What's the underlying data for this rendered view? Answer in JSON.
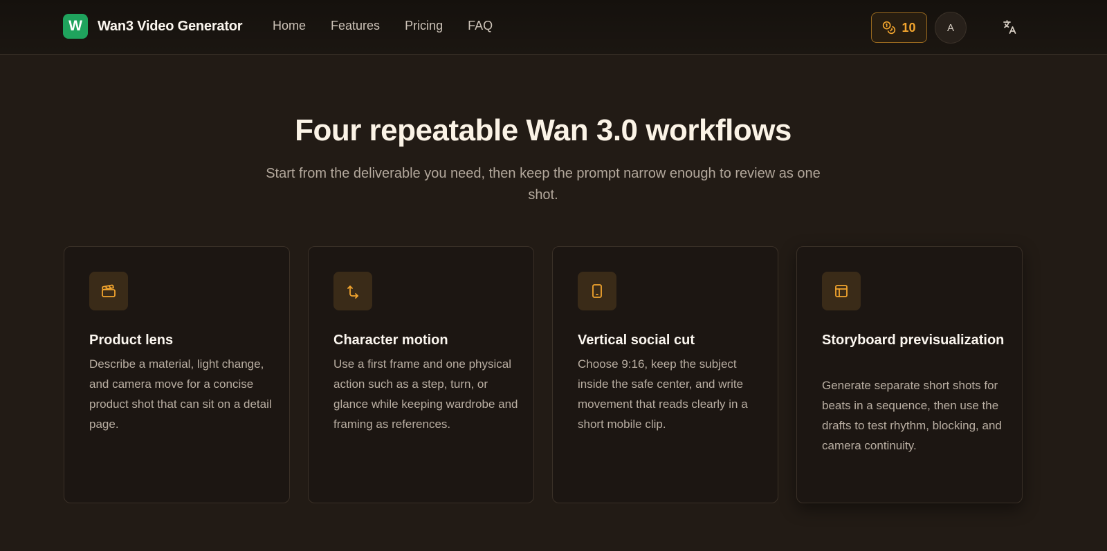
{
  "header": {
    "logo_letter": "W",
    "brand_name": "Wan3 Video Generator",
    "nav": [
      "Home",
      "Features",
      "Pricing",
      "FAQ"
    ],
    "credits": "10",
    "avatar_letter": "A"
  },
  "hero": {
    "title": "Four repeatable Wan 3.0 workflows",
    "subtitle": "Start from the deliverable you need, then keep the prompt narrow enough to review as one shot."
  },
  "cards": [
    {
      "icon": "clapperboard-icon",
      "title": "Product lens",
      "description": "Describe a material, light change, and camera move for a concise product shot that can sit on a detail page."
    },
    {
      "icon": "move-axis-icon",
      "title": "Character motion",
      "description": "Use a first frame and one physical action such as a step, turn, or glance while keeping wardrobe and framing as references."
    },
    {
      "icon": "phone-icon",
      "title": "Vertical social cut",
      "description": "Choose 9:16, keep the subject inside the safe center, and write movement that reads clearly in a short mobile clip."
    },
    {
      "icon": "layout-panel-icon",
      "title": "Storyboard previsualization",
      "description": "Generate separate short shots for beats in a sequence, then use the drafts to test rhythm, blocking, and camera continuity."
    }
  ],
  "colors": {
    "background": "#221b15",
    "accent": "#f2a52e",
    "logo": "#1fa35d",
    "card": "#1c1612"
  }
}
